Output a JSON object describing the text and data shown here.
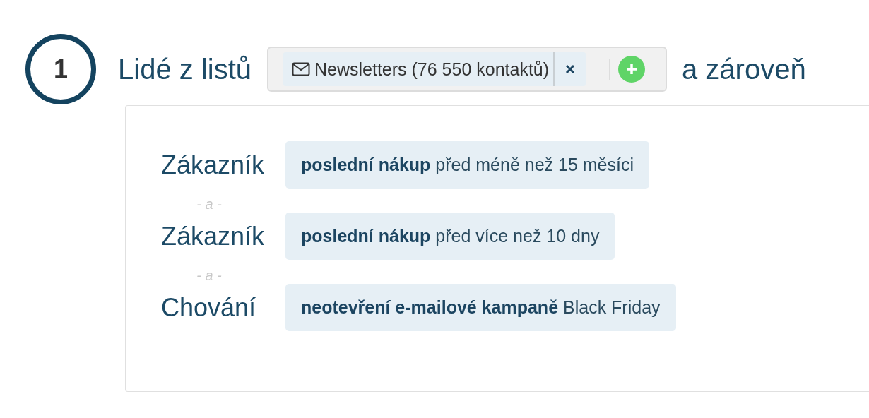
{
  "step": {
    "number": "1",
    "title": "Lidé z listů",
    "connector": "a zároveň"
  },
  "lists": [
    {
      "label": "Newsletters (76 550 kontaktů)"
    }
  ],
  "conditions": [
    {
      "label": "Zákazník",
      "rule": "**poslední nákup** před méně než 15 měsíci"
    },
    {
      "label": "Zákazník",
      "rule": "**poslední nákup** před více než 10 dny"
    },
    {
      "label": "Chování",
      "rule": "**neotevření e-mailové kampaně** Black Friday"
    }
  ],
  "joiners": [
    "- a -",
    "- a -"
  ]
}
